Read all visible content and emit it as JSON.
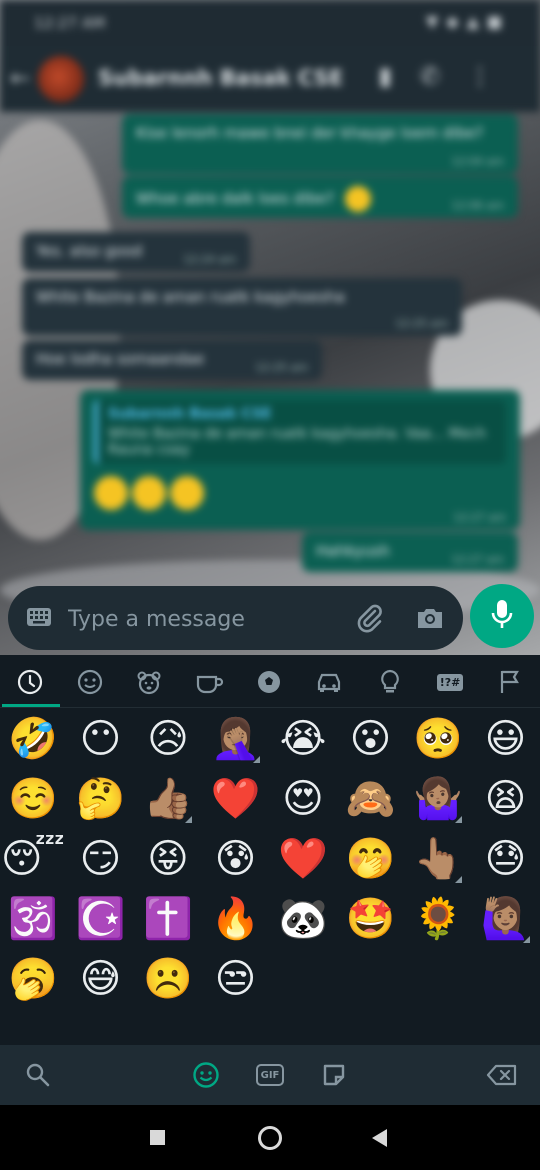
{
  "status_bar": {
    "time": "12:27 AM"
  },
  "chat": {
    "contact_name": "Subarnnh Basak CSE",
    "messages": [
      {
        "text": "Kise lenorh mawe bnei der khayge loem dibe?",
        "time": "12:04 am"
      },
      {
        "text": "Whoe abre dalk loes dibe?",
        "time": "12:06 am"
      },
      {
        "text": "Yes. also good",
        "time": "12:24 am"
      },
      {
        "text": "White Bazina de aman ruatk kagyhoesha",
        "time": "12:25 am"
      },
      {
        "text": "Hoe lodha somaandae",
        "time": "12:25 am"
      },
      {
        "quote_name": "Subarnnh Basak CSE",
        "quote_text": "White Bazina de aman ruatk kagyhoesha. Vaa... Mech Rauna coay",
        "time": "12:27 am"
      },
      {
        "text": "Hahkyush",
        "time": "12:27 am"
      }
    ]
  },
  "composer": {
    "placeholder": "Type a message"
  },
  "emoji_panel": {
    "categories": [
      "recent",
      "smileys",
      "animals",
      "food",
      "activity",
      "travel",
      "objects",
      "symbols",
      "flags"
    ],
    "active_category": "recent",
    "symbols_label": "!?#",
    "rows": [
      [
        "🤣",
        "😶",
        "😥",
        "🤦🏽‍♀️",
        "😭",
        "😮",
        "🥺",
        "😃"
      ],
      [
        "☺️",
        "🤔",
        "👍🏽",
        "❤️",
        "😍",
        "🙈",
        "🤷🏽‍♀️",
        "😫"
      ],
      [
        "😴",
        "😏",
        "😝",
        "😰",
        "❤️",
        "🤭",
        "👆🏽",
        "😓"
      ],
      [
        "🕉️",
        "☪️",
        "✝️",
        "🔥",
        "🐼",
        "🤩",
        "🌻",
        "🙋🏽‍♀️"
      ],
      [
        "🥱",
        "😅",
        "☹️",
        "😒"
      ]
    ],
    "tone_marks": [
      "r1c4",
      "r2c3",
      "r2c7",
      "r3c7",
      "r4c8"
    ]
  },
  "bottom_bar": {
    "gif_label": "GIF"
  },
  "colors": {
    "accent": "#00a884",
    "panel_bg": "#121b22",
    "bar_bg": "#1f2c34",
    "icon_gray": "#8696a0"
  }
}
